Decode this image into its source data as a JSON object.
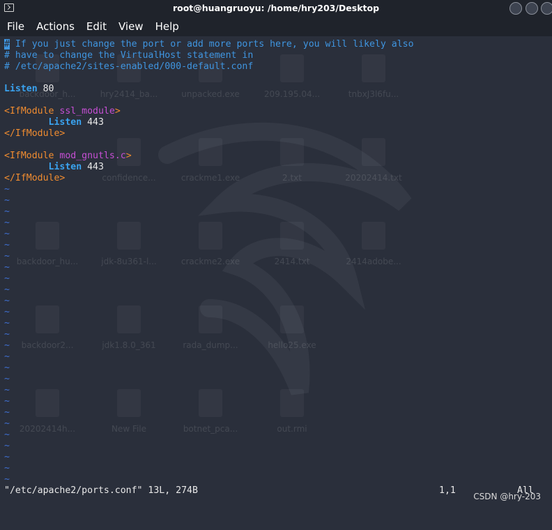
{
  "window": {
    "title": "root@huangruoyu: /home/hry203/Desktop"
  },
  "menu": [
    "File",
    "Actions",
    "Edit",
    "View",
    "Help"
  ],
  "editor": {
    "cursor_char": "#",
    "lines": [
      {
        "segments": [
          {
            "t": " If you just change the port or add more ports here, you will likely also",
            "c": "comment"
          }
        ],
        "cursor": true
      },
      {
        "segments": [
          {
            "t": "# have to change the VirtualHost statement in",
            "c": "comment"
          }
        ]
      },
      {
        "segments": [
          {
            "t": "# /etc/apache2/sites-enabled/000-default.conf",
            "c": "comment"
          }
        ]
      },
      {
        "segments": []
      },
      {
        "segments": [
          {
            "t": "Listen",
            "c": "keyword"
          },
          {
            "t": " 80",
            "c": "plain"
          }
        ]
      },
      {
        "segments": []
      },
      {
        "segments": [
          {
            "t": "<IfModule ",
            "c": "tag"
          },
          {
            "t": "ssl_module",
            "c": "mod"
          },
          {
            "t": ">",
            "c": "tag"
          }
        ]
      },
      {
        "segments": [
          {
            "t": "        ",
            "c": "plain"
          },
          {
            "t": "Listen",
            "c": "keyword"
          },
          {
            "t": " 443",
            "c": "plain"
          }
        ]
      },
      {
        "segments": [
          {
            "t": "</IfModule>",
            "c": "tag"
          }
        ]
      },
      {
        "segments": []
      },
      {
        "segments": [
          {
            "t": "<IfModule ",
            "c": "tag"
          },
          {
            "t": "mod_gnutls.c",
            "c": "mod"
          },
          {
            "t": ">",
            "c": "tag"
          }
        ]
      },
      {
        "segments": [
          {
            "t": "        ",
            "c": "plain"
          },
          {
            "t": "Listen",
            "c": "keyword"
          },
          {
            "t": " 443",
            "c": "plain"
          }
        ]
      },
      {
        "segments": [
          {
            "t": "</IfModule>",
            "c": "tag"
          }
        ]
      }
    ],
    "empty_line_marker": "~",
    "empty_line_count": 27
  },
  "status": {
    "message": "\"/etc/apache2/ports.conf\" 13L, 274B",
    "position": "1,1",
    "scroll": "All"
  },
  "watermark": "CSDN @hry-203",
  "desktop_icons": [
    "backdoor_h...",
    "hry2414_ba...",
    "unpacked.exe",
    "209.195.04...",
    "tnbxJ3l6fu...",
    "confidence...",
    "crackme1.exe",
    "2.txt",
    "20202414.txt",
    "backdoor_hu...",
    "jdk-8u361-l...",
    "crackme2.exe",
    "2414.txt",
    "2414adobe...",
    "backdoor2...",
    "jdk1.8.0_361",
    "rada_dump...",
    "hello25.exe",
    "20202414h...",
    "New File",
    "botnet_pca...",
    "out.rmi"
  ],
  "colors": {
    "background": "#2a2f3b",
    "titlebar": "#1f232b",
    "comment": "#3f95e0",
    "keyword": "#3aa3f0",
    "tag": "#f08c30",
    "module": "#c64fd4",
    "tilde": "#3f6fd1"
  }
}
